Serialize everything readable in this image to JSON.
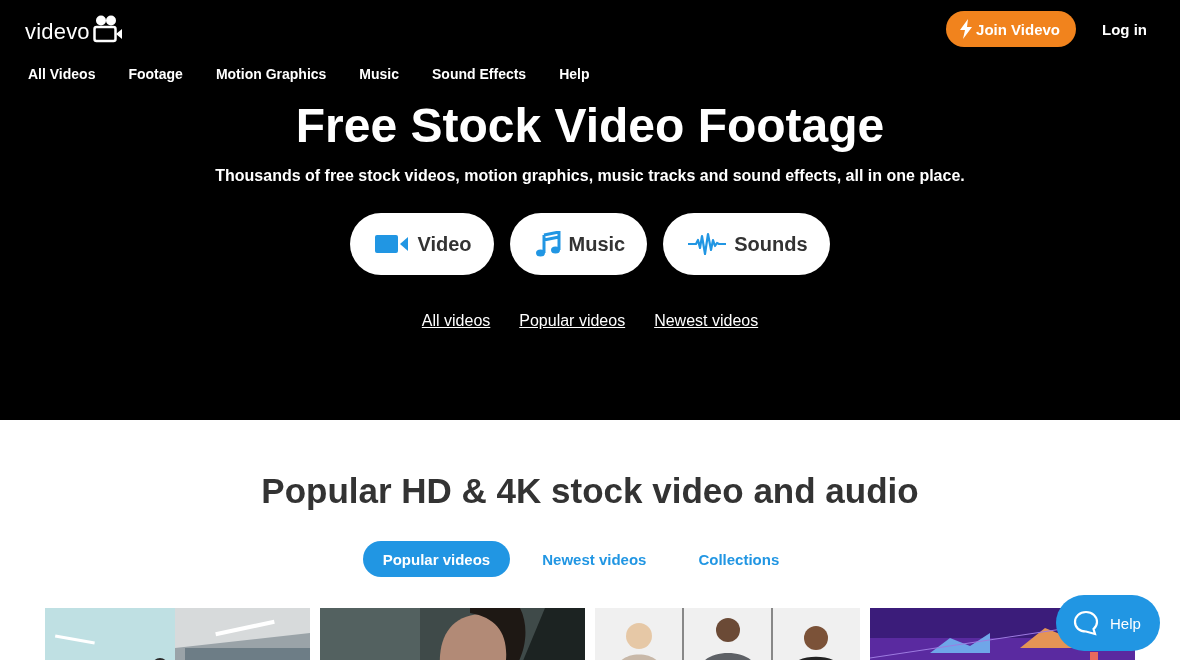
{
  "logo": {
    "text": "videvo"
  },
  "header_actions": [
    {
      "kind": "primary",
      "label": "Join Videvo"
    },
    {
      "kind": "link",
      "label": "Log in"
    }
  ],
  "nav": [
    "All Videos",
    "Footage",
    "Motion Graphics",
    "Music",
    "Sound Effects",
    "Help"
  ],
  "hero": {
    "title": "Free Stock Video Footage",
    "subtitle": "Thousands of free stock videos, motion graphics, music tracks and sound effects, all in one place.",
    "media_buttons": [
      {
        "kind": "video",
        "label": "Video"
      },
      {
        "kind": "music",
        "label": "Music"
      },
      {
        "kind": "sounds",
        "label": "Sounds"
      }
    ],
    "links": [
      "All videos",
      "Popular videos",
      "Newest videos"
    ]
  },
  "section": {
    "heading": "Popular HD & 4K stock video and audio",
    "tabs": [
      {
        "label": "Popular videos",
        "selected": true
      },
      {
        "label": "Newest videos",
        "selected": false
      },
      {
        "label": "Collections",
        "selected": false
      }
    ]
  },
  "help_widget": {
    "label": "Help"
  }
}
